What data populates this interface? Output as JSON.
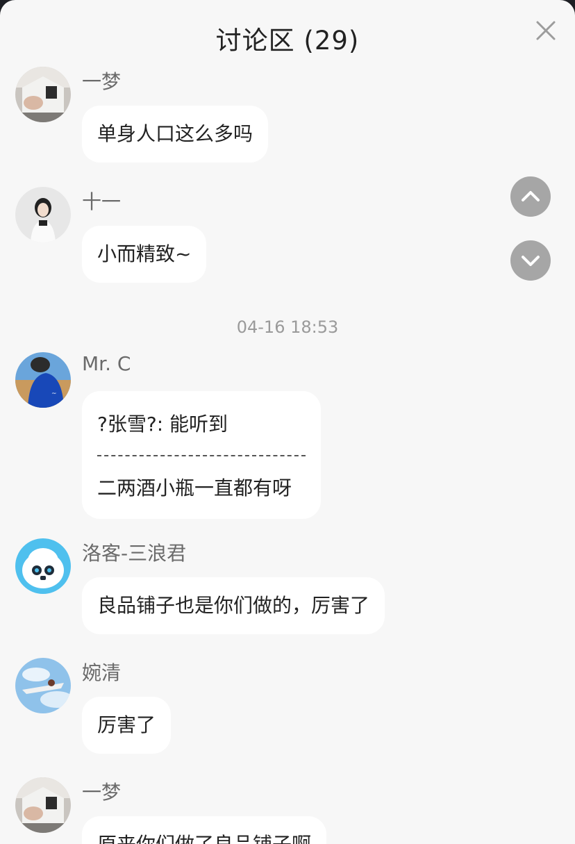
{
  "header": {
    "title": "讨论区 (29)",
    "close_icon": "close-icon"
  },
  "nav": {
    "scroll_up_icon": "chevron-up-icon",
    "scroll_down_icon": "chevron-down-icon"
  },
  "timestamp": "04-16 18:53",
  "messages": [
    {
      "name": "一梦",
      "text": "单身人口这么多吗"
    },
    {
      "name": "十一",
      "text": "小而精致~"
    },
    {
      "name": "Mr. C",
      "quote": "?张雪?: 能听到",
      "text": "二两酒小瓶一直都有呀"
    },
    {
      "name": "洛客-三浪君",
      "text": "良品铺子也是你们做的，厉害了"
    },
    {
      "name": "婉清",
      "text": "厉害了"
    },
    {
      "name": "一梦",
      "text": "原来你们做了良品铺子啊"
    }
  ]
}
